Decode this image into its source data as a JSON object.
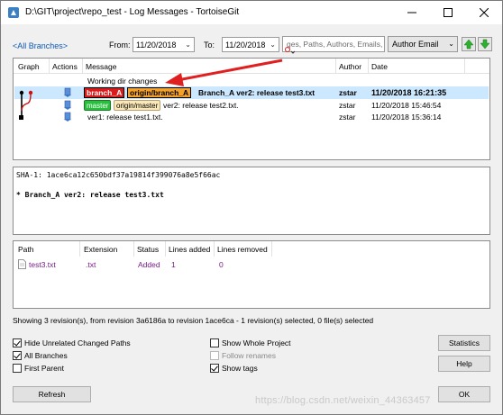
{
  "window": {
    "title": "D:\\GIT\\project\\repo_test - Log Messages - TortoiseGit"
  },
  "toolbar": {
    "all_branches_link": "<All Branches>",
    "from_label": "From:",
    "from_date": "11/20/2018",
    "to_label": "To:",
    "to_date": "11/20/2018",
    "search_placeholder": "ges, Paths, Authors, Emails, I",
    "filter_by": "Author Email"
  },
  "log_columns": [
    "Graph",
    "Actions",
    "Message",
    "Author",
    "Date"
  ],
  "log_rows": [
    {
      "message": "Working dir changes",
      "author": "",
      "date": ""
    },
    {
      "tags": [
        "branch_A",
        "origin/branch_A"
      ],
      "message": "Branch_A ver2: release test3.txt",
      "author": "zstar",
      "date": "11/20/2018 16:21:35",
      "selected": true
    },
    {
      "tags": [
        "master",
        "origin/master"
      ],
      "message": "ver2: release test2.txt.",
      "author": "zstar",
      "date": "11/20/2018 15:46:54"
    },
    {
      "message": "ver1: release test1.txt.",
      "author": "zstar",
      "date": "11/20/2018 15:36:14"
    }
  ],
  "message_pane": {
    "sha_line": "SHA-1: 1ace6ca12c650bdf37a19814f399076a8e5f66ac",
    "body_line": "* Branch_A ver2: release test3.txt"
  },
  "file_columns": [
    "Path",
    "Extension",
    "Status",
    "Lines added",
    "Lines removed"
  ],
  "files": [
    {
      "path": "test3.txt",
      "extension": ".txt",
      "status": "Added",
      "lines_added": "1",
      "lines_removed": "0"
    }
  ],
  "status_text": "Showing 3 revision(s), from revision 3a6186a to revision 1ace6ca - 1 revision(s) selected, 0 file(s) selected",
  "options": {
    "hide_unrelated": "Hide Unrelated Changed Paths",
    "all_branches": "All Branches",
    "first_parent": "First Parent",
    "show_whole_project": "Show Whole Project",
    "follow_renames": "Follow renames",
    "show_tags": "Show tags"
  },
  "buttons": {
    "statistics": "Statistics",
    "help": "Help",
    "refresh": "Refresh",
    "ok": "OK"
  },
  "watermark": "https://blog.csdn.net/weixin_44363457",
  "colors": {
    "selection": "#cce8ff",
    "link": "#0b59b3",
    "branch_tag": "#d81b1b",
    "remote_tag": "#f3a12d",
    "master_tag": "#27c03c",
    "annotation_arrow": "#e02020"
  }
}
